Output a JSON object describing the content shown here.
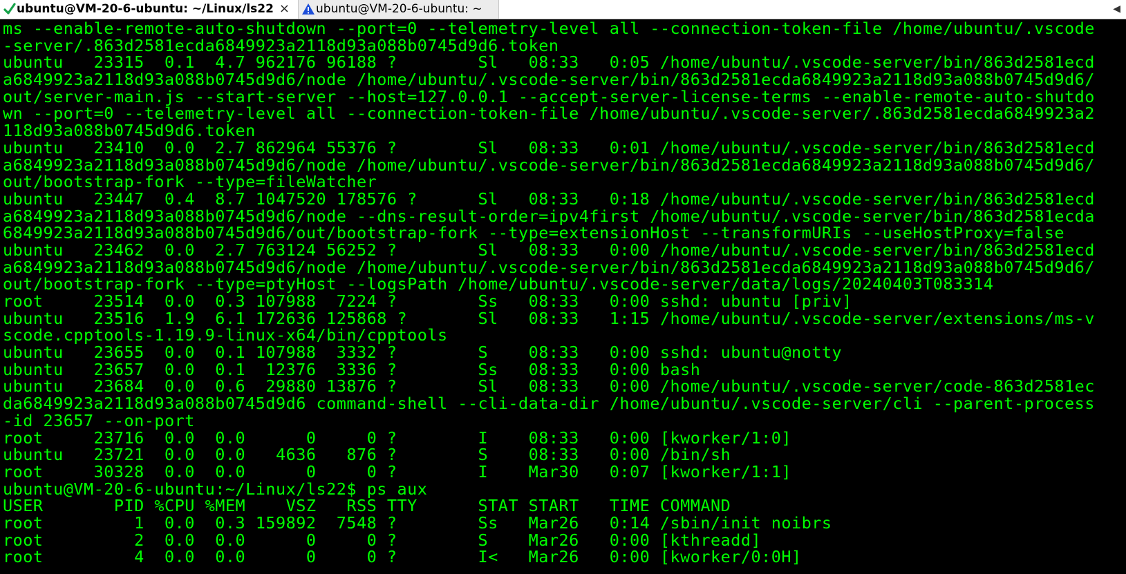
{
  "tabs": [
    {
      "label": "ubuntu@VM-20-6-ubuntu: ~/Linux/ls22",
      "status": "connected",
      "active": true,
      "close": "×"
    },
    {
      "label": "ubuntu@VM-20-6-ubuntu: ~",
      "status": "warning",
      "active": false
    }
  ],
  "colors": {
    "terminal_bg": "#000000",
    "terminal_fg": "#00ff00",
    "tab_ok": "#16a34a",
    "tab_warn": "#1d4ed8"
  },
  "terminal": {
    "lines": [
      "ms --enable-remote-auto-shutdown --port=0 --telemetry-level all --connection-token-file /home/ubuntu/.vscode",
      "-server/.863d2581ecda6849923a2118d93a088b0745d9d6.token",
      "ubuntu   23315  0.1  4.7 962176 96188 ?        Sl   08:33   0:05 /home/ubuntu/.vscode-server/bin/863d2581ecd",
      "a6849923a2118d93a088b0745d9d6/node /home/ubuntu/.vscode-server/bin/863d2581ecda6849923a2118d93a088b0745d9d6/",
      "out/server-main.js --start-server --host=127.0.0.1 --accept-server-license-terms --enable-remote-auto-shutdo",
      "wn --port=0 --telemetry-level all --connection-token-file /home/ubuntu/.vscode-server/.863d2581ecda6849923a2",
      "118d93a088b0745d9d6.token",
      "ubuntu   23410  0.0  2.7 862964 55376 ?        Sl   08:33   0:01 /home/ubuntu/.vscode-server/bin/863d2581ecd",
      "a6849923a2118d93a088b0745d9d6/node /home/ubuntu/.vscode-server/bin/863d2581ecda6849923a2118d93a088b0745d9d6/",
      "out/bootstrap-fork --type=fileWatcher",
      "ubuntu   23447  0.4  8.7 1047520 178576 ?      Sl   08:33   0:18 /home/ubuntu/.vscode-server/bin/863d2581ecd",
      "a6849923a2118d93a088b0745d9d6/node --dns-result-order=ipv4first /home/ubuntu/.vscode-server/bin/863d2581ecda",
      "6849923a2118d93a088b0745d9d6/out/bootstrap-fork --type=extensionHost --transformURIs --useHostProxy=false",
      "ubuntu   23462  0.0  2.7 763124 56252 ?        Sl   08:33   0:00 /home/ubuntu/.vscode-server/bin/863d2581ecd",
      "a6849923a2118d93a088b0745d9d6/node /home/ubuntu/.vscode-server/bin/863d2581ecda6849923a2118d93a088b0745d9d6/",
      "out/bootstrap-fork --type=ptyHost --logsPath /home/ubuntu/.vscode-server/data/logs/20240403T083314",
      "root     23514  0.0  0.3 107988  7224 ?        Ss   08:33   0:00 sshd: ubuntu [priv]",
      "ubuntu   23516  1.9  6.1 172636 125868 ?       Sl   08:33   1:15 /home/ubuntu/.vscode-server/extensions/ms-v",
      "scode.cpptools-1.19.9-linux-x64/bin/cpptools",
      "ubuntu   23655  0.0  0.1 107988  3332 ?        S    08:33   0:00 sshd: ubuntu@notty",
      "ubuntu   23657  0.0  0.1  12376  3336 ?        Ss   08:33   0:00 bash",
      "ubuntu   23684  0.0  0.6  29880 13876 ?        Sl   08:33   0:00 /home/ubuntu/.vscode-server/code-863d2581ec",
      "da6849923a2118d93a088b0745d9d6 command-shell --cli-data-dir /home/ubuntu/.vscode-server/cli --parent-process",
      "-id 23657 --on-port",
      "root     23716  0.0  0.0      0     0 ?        I    08:33   0:00 [kworker/1:0]",
      "ubuntu   23721  0.0  0.0   4636   876 ?        S    08:33   0:00 /bin/sh",
      "root     30328  0.0  0.0      0     0 ?        I    Mar30   0:07 [kworker/1:1]",
      "ubuntu@VM-20-6-ubuntu:~/Linux/ls22$ ps aux",
      "USER       PID %CPU %MEM    VSZ   RSS TTY      STAT START   TIME COMMAND",
      "root         1  0.0  0.3 159892  7548 ?        Ss   Mar26   0:14 /sbin/init noibrs",
      "root         2  0.0  0.0      0     0 ?        S    Mar26   0:00 [kthreadd]",
      "root         4  0.0  0.0      0     0 ?        I<   Mar26   0:00 [kworker/0:0H]"
    ]
  }
}
